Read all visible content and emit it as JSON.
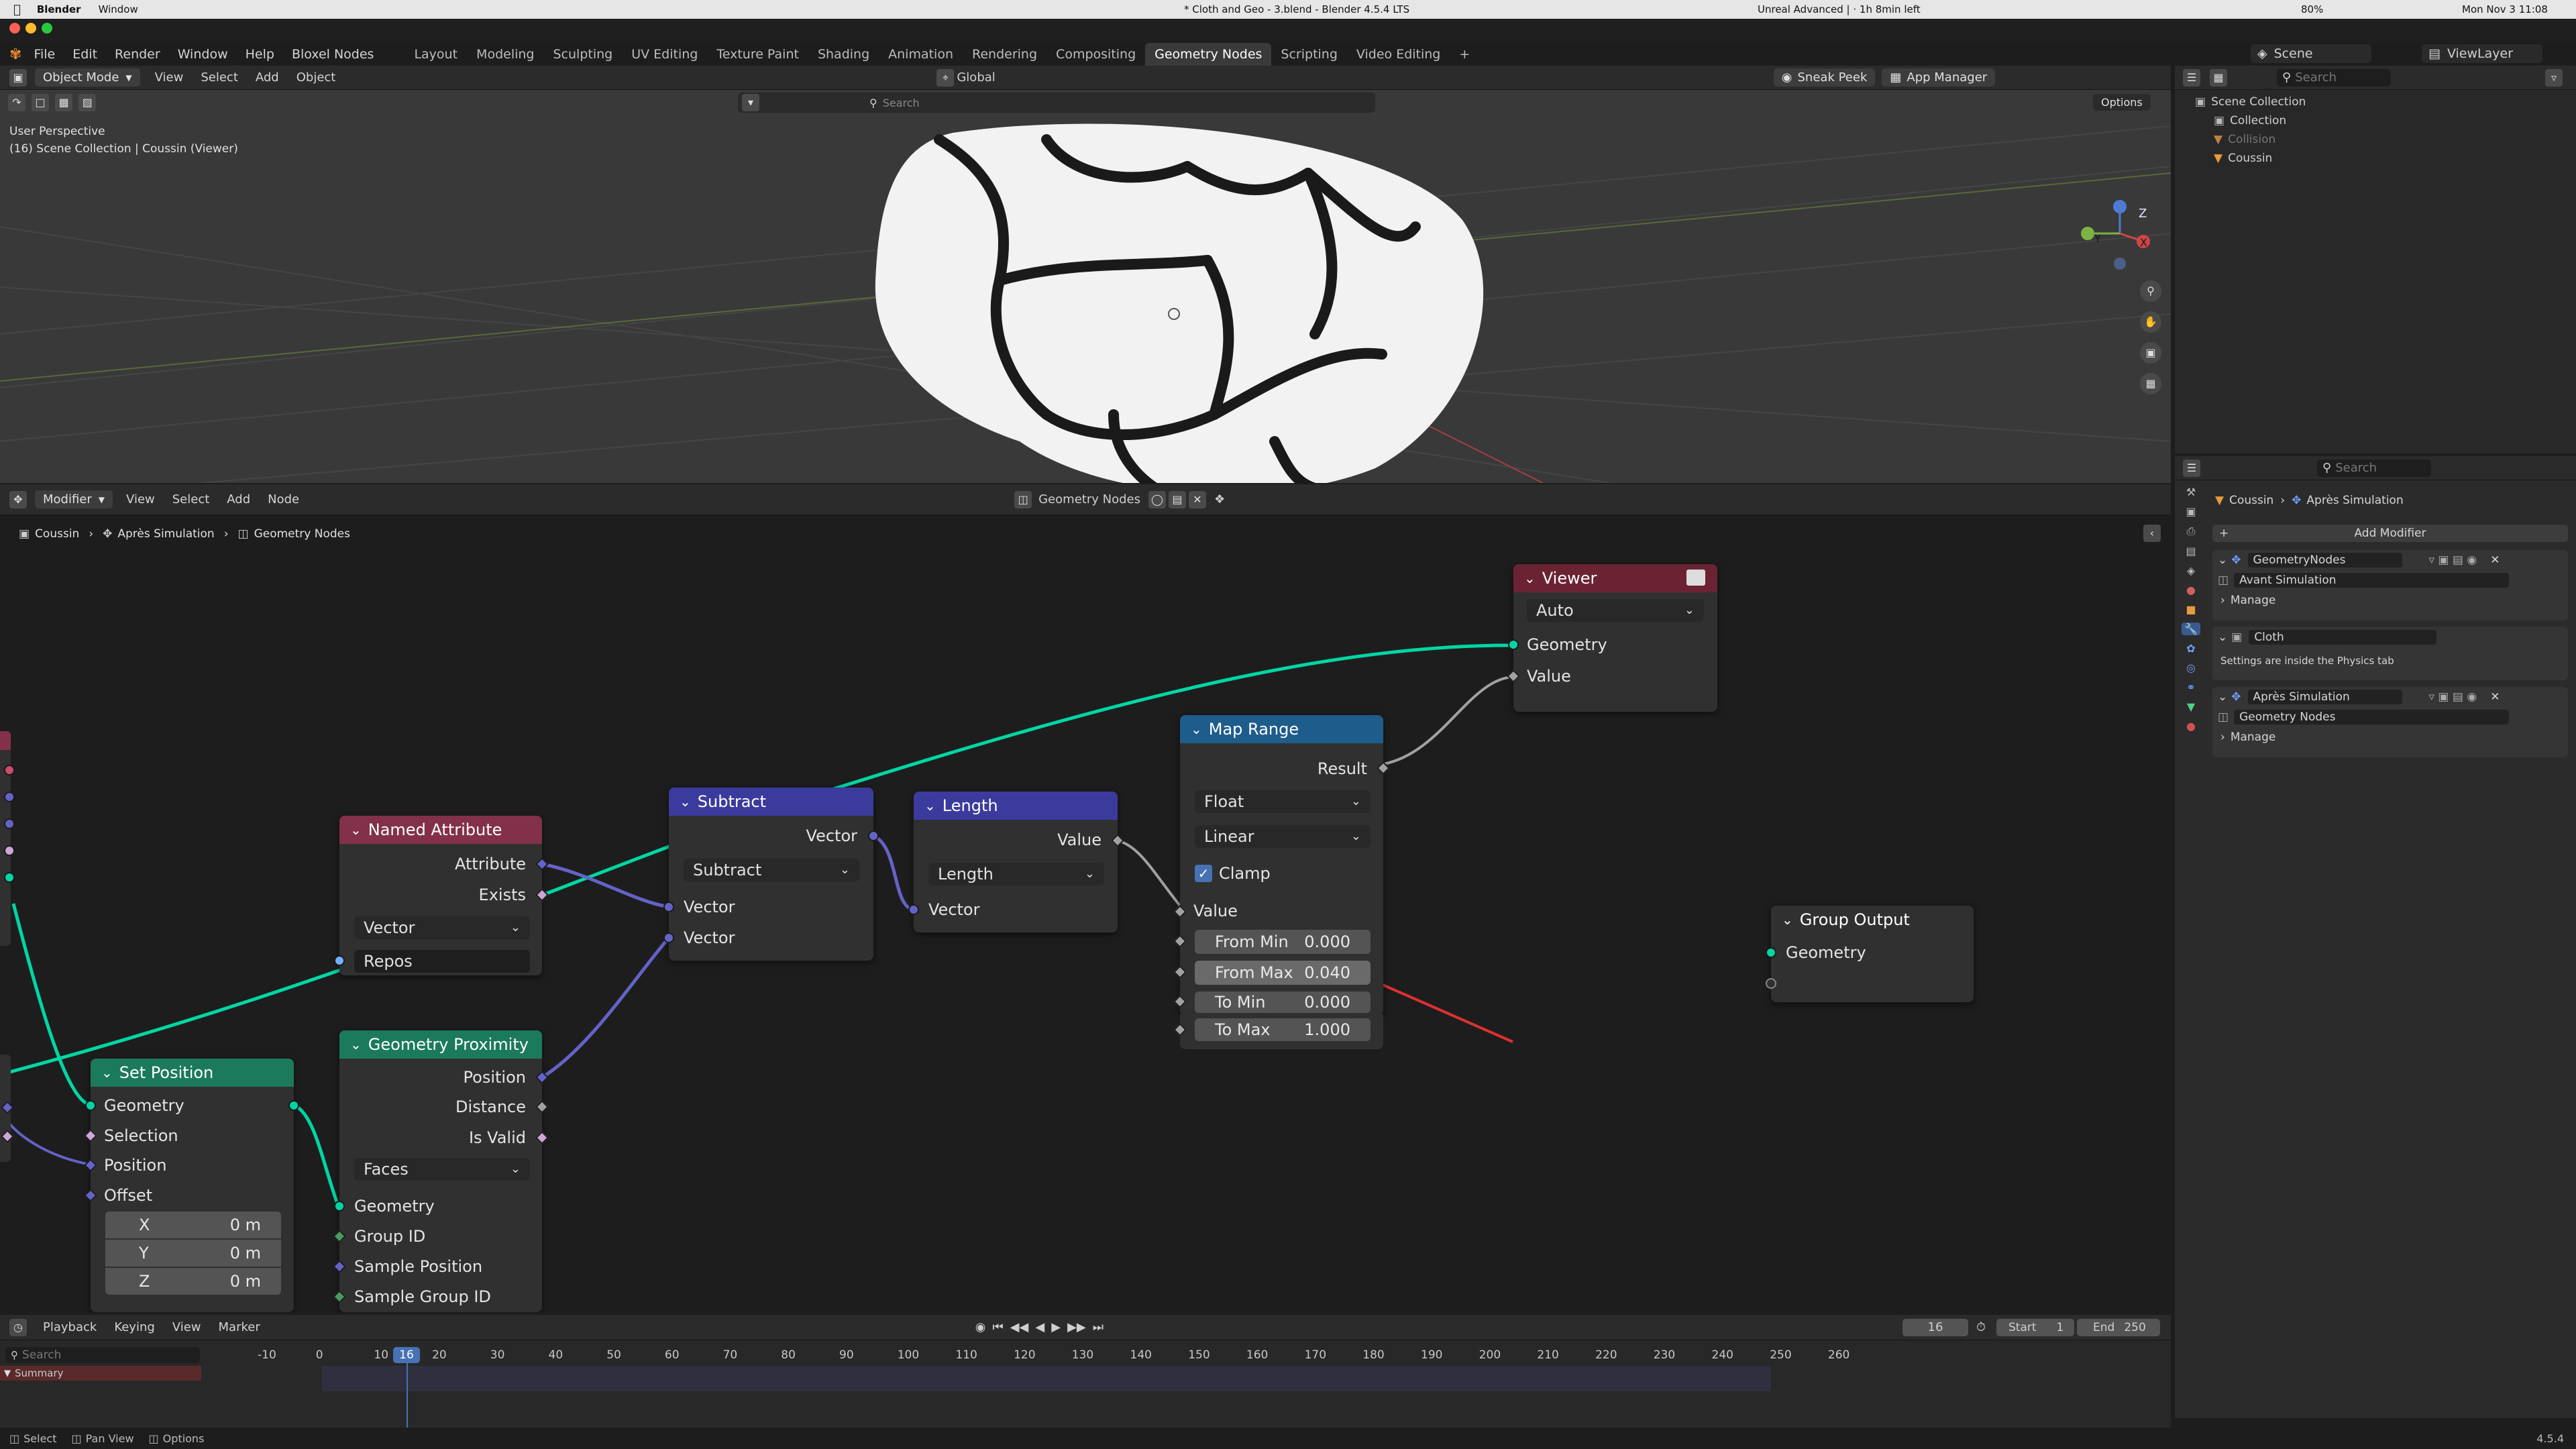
{
  "menubar": {
    "app": "Blender",
    "window": "Window",
    "title": "* Cloth and Geo - 3.blend - Blender 4.5.4 LTS",
    "right_text": "Unreal Advanced | · 1h 8min left",
    "battery": "80%",
    "clock": "Mon Nov 3 11:08"
  },
  "topbar": {
    "menus": [
      "File",
      "Edit",
      "Render",
      "Window",
      "Help",
      "Bloxel Nodes"
    ],
    "workspaces": [
      "Layout",
      "Modeling",
      "Sculpting",
      "UV Editing",
      "Texture Paint",
      "Shading",
      "Animation",
      "Rendering",
      "Compositing",
      "Geometry Nodes",
      "Scripting",
      "Video Editing"
    ],
    "active_workspace": "Geometry Nodes",
    "scene": "Scene",
    "view_layer": "ViewLayer"
  },
  "viewport": {
    "mode": "Object Mode",
    "menus": [
      "View",
      "Select",
      "Add",
      "Object"
    ],
    "orientation": "Global",
    "search_placeholder": "Search",
    "perspective": "User Perspective",
    "collection_info": "(16) Scene Collection | Coussin (Viewer)",
    "sneak_peek": "Sneak Peek",
    "app_manager": "App Manager",
    "options": "Options",
    "axis_labels": [
      "Z",
      "Y",
      "X"
    ]
  },
  "outliner": {
    "search_placeholder": "Search",
    "items": [
      "Scene Collection",
      "Collection",
      "Collision",
      "Coussin"
    ]
  },
  "node_editor": {
    "type": "Modifier",
    "menus": [
      "View",
      "Select",
      "Add",
      "Node"
    ],
    "tree_name": "Geometry Nodes",
    "breadcrumb": [
      "Coussin",
      "Après Simulation",
      "Geometry Nodes"
    ],
    "nodes": {
      "viewer": {
        "title": "Viewer",
        "domain": "Auto",
        "inputs": [
          "Geometry",
          "Value"
        ]
      },
      "map_range": {
        "title": "Map Range",
        "output": "Result",
        "data_type": "Float",
        "interpolation": "Linear",
        "clamp_label": "Clamp",
        "clamp": true,
        "value_input": "Value",
        "fields": [
          {
            "label": "From Min",
            "value": "0.000"
          },
          {
            "label": "From Max",
            "value": "0.040"
          },
          {
            "label": "To Min",
            "value": "0.000"
          },
          {
            "label": "To Max",
            "value": "1.000"
          }
        ]
      },
      "subtract": {
        "title": "Subtract",
        "output": "Vector",
        "operation": "Subtract",
        "inputs": [
          "Vector",
          "Vector"
        ]
      },
      "length": {
        "title": "Length",
        "output": "Value",
        "operation": "Length",
        "input": "Vector"
      },
      "named_attribute": {
        "title": "Named Attribute",
        "outputs": [
          "Attribute",
          "Exists"
        ],
        "data_type": "Vector",
        "name": "Repos"
      },
      "geometry_proximity": {
        "title": "Geometry Proximity",
        "outputs": [
          "Position",
          "Distance",
          "Is Valid"
        ],
        "target": "Faces",
        "inputs": [
          "Geometry",
          "Group ID",
          "Sample Position",
          "Sample Group ID"
        ]
      },
      "set_position": {
        "title": "Set Position",
        "output": "Geometry",
        "inputs": [
          "Geometry",
          "Selection",
          "Position",
          "Offset"
        ],
        "offset": [
          {
            "axis": "X",
            "value": "0 m"
          },
          {
            "axis": "Y",
            "value": "0 m"
          },
          {
            "axis": "Z",
            "value": "0 m"
          }
        ]
      },
      "group_output": {
        "title": "Group Output",
        "input": "Geometry"
      }
    }
  },
  "properties": {
    "search_placeholder": "Search",
    "breadcrumb": [
      "Coussin",
      "Après Simulation"
    ],
    "add_modifier": "Add Modifier",
    "modifiers": [
      {
        "name": "GeometryNodes",
        "tree": "Avant Simulation",
        "manage": "Manage"
      },
      {
        "name": "Cloth",
        "note": "Settings are inside the Physics tab"
      },
      {
        "name": "Après Simulation",
        "tree": "Geometry Nodes",
        "manage": "Manage"
      }
    ]
  },
  "timeline": {
    "menus": [
      "Playback",
      "Keying",
      "View",
      "Marker"
    ],
    "current_frame": "16",
    "start_label": "Start",
    "start": "1",
    "end_label": "End",
    "end": "250",
    "search_placeholder": "Search",
    "summary": "Summary",
    "ticks": [
      "-10",
      "0",
      "10",
      "20",
      "30",
      "40",
      "50",
      "60",
      "70",
      "80",
      "90",
      "100",
      "110",
      "120",
      "130",
      "140",
      "150",
      "160",
      "170",
      "180",
      "190",
      "200",
      "210",
      "220",
      "230",
      "240",
      "250",
      "260"
    ]
  },
  "statusbar": {
    "items": [
      "Select",
      "Pan View",
      "Options"
    ],
    "version": "4.5.4"
  },
  "colors": {
    "geometry_socket": "#00d6a3",
    "vector_socket": "#6363c7",
    "float_socket": "#a1a1a1",
    "bool_socket": "#cca6d6",
    "input_header": "#83314a",
    "vector_header": "#3b3b9e",
    "converter_header": "#1e5c8c",
    "geometry_header": "#1c7a5c",
    "output_header": "#6b2333",
    "accent": "#4772b3"
  }
}
